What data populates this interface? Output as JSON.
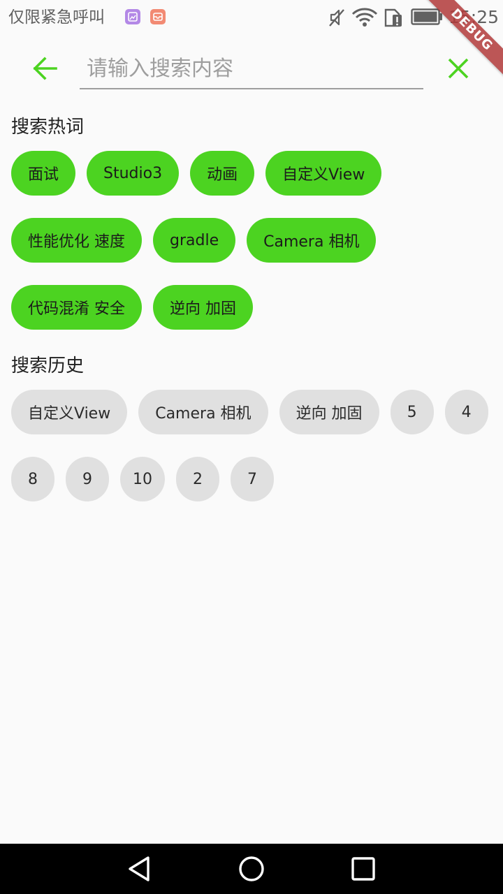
{
  "status_bar": {
    "carrier": "仅限紧急呼叫",
    "time": "15:25"
  },
  "debug_banner": "DEBUG",
  "search": {
    "placeholder": "请输入搜索内容",
    "value": ""
  },
  "hot": {
    "title": "搜索热词",
    "items": [
      "面试",
      "Studio3",
      "动画",
      "自定义View",
      "性能优化 速度",
      "gradle",
      "Camera 相机",
      "代码混淆 安全",
      "逆向 加固"
    ]
  },
  "history": {
    "title": "搜索历史",
    "items": [
      "自定义View",
      "Camera 相机",
      "逆向 加固",
      "5",
      "4",
      "8",
      "9",
      "10",
      "2",
      "7"
    ]
  },
  "colors": {
    "accent": "#4cd321",
    "history_chip": "#e0e0e0",
    "background": "#fafafa",
    "nav_bar": "#000000"
  },
  "icons": {
    "back": "arrow-left-icon",
    "clear": "close-icon",
    "nav_back": "triangle-back-icon",
    "nav_home": "circle-home-icon",
    "nav_recents": "square-recents-icon"
  }
}
